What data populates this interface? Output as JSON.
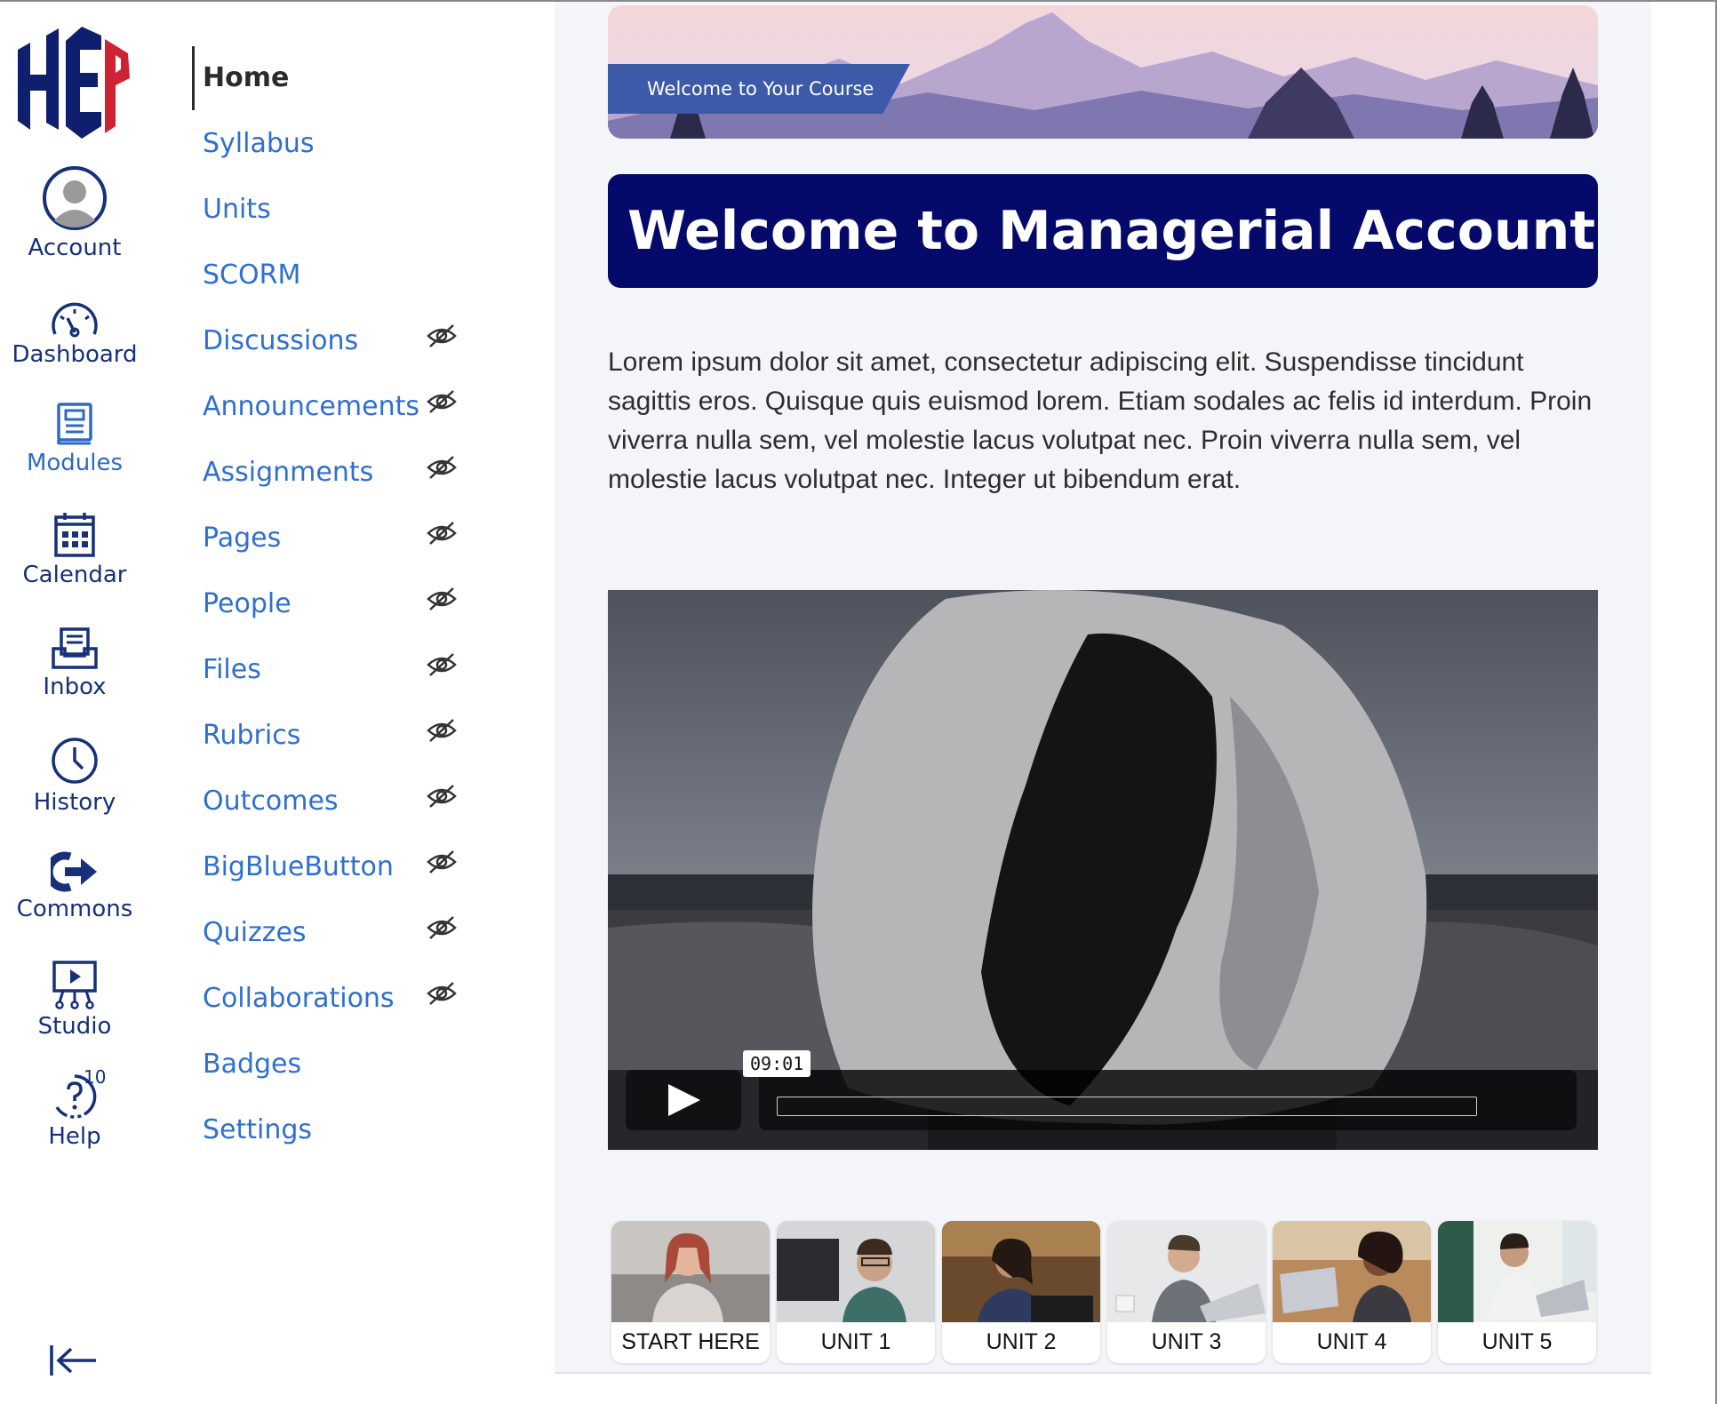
{
  "global_nav": {
    "logo_text": "HEP",
    "items": [
      {
        "label": "Account",
        "icon": "account-avatar-icon"
      },
      {
        "label": "Dashboard",
        "icon": "dashboard-gauge-icon"
      },
      {
        "label": "Modules",
        "icon": "modules-book-icon",
        "active": true
      },
      {
        "label": "Calendar",
        "icon": "calendar-icon"
      },
      {
        "label": "Inbox",
        "icon": "inbox-icon"
      },
      {
        "label": "History",
        "icon": "clock-icon"
      },
      {
        "label": "Commons",
        "icon": "commons-arrow-icon"
      },
      {
        "label": "Studio",
        "icon": "studio-icon"
      },
      {
        "label": "Help",
        "icon": "help-icon",
        "badge": "10"
      }
    ],
    "collapse_icon": "collapse-nav-icon"
  },
  "course_nav": {
    "items": [
      {
        "label": "Home",
        "active": true,
        "hidden": false
      },
      {
        "label": "Syllabus",
        "hidden": false
      },
      {
        "label": "Units",
        "hidden": false
      },
      {
        "label": "SCORM",
        "hidden": false
      },
      {
        "label": "Discussions",
        "hidden": true
      },
      {
        "label": "Announcements",
        "hidden": true
      },
      {
        "label": "Assignments",
        "hidden": true
      },
      {
        "label": "Pages",
        "hidden": true
      },
      {
        "label": "People",
        "hidden": true
      },
      {
        "label": "Files",
        "hidden": true
      },
      {
        "label": "Rubrics",
        "hidden": true
      },
      {
        "label": "Outcomes",
        "hidden": true
      },
      {
        "label": "BigBlueButton",
        "hidden": true
      },
      {
        "label": "Quizzes",
        "hidden": true
      },
      {
        "label": "Collaborations",
        "hidden": true
      },
      {
        "label": "Badges",
        "hidden": false
      },
      {
        "label": "Settings",
        "hidden": false
      }
    ]
  },
  "main": {
    "banner_label": "Welcome to Your Course",
    "title": "Welcome to Managerial Accounting",
    "body": "Lorem ipsum dolor sit amet, consectetur adipiscing elit. Suspendisse tincidunt sagittis eros. Quisque quis euismod lorem. Etiam sodales ac felis id interdum. Proin viverra nulla sem, vel molestie lacus volutpat nec. Proin viverra nulla sem, vel molestie lacus volutpat nec. Integer ut bibendum erat.",
    "video": {
      "time": "09:01"
    },
    "units": [
      {
        "label": "START HERE"
      },
      {
        "label": "UNIT 1"
      },
      {
        "label": "UNIT 2"
      },
      {
        "label": "UNIT 3"
      },
      {
        "label": "UNIT 4"
      },
      {
        "label": "UNIT 5"
      }
    ]
  },
  "colors": {
    "nav_text": "#16307a",
    "link": "#2f6fd0",
    "title_bg": "#050a6a",
    "banner_tab": "#3d5aa8",
    "page_bg": "#f4f5f9"
  }
}
